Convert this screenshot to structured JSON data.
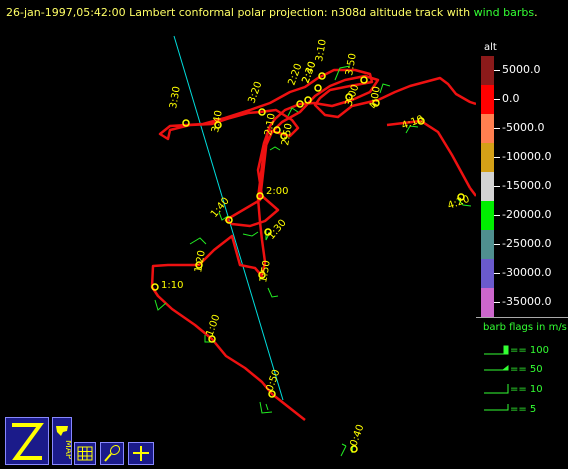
{
  "header": {
    "title_prefix": "26-jan-1997,05:42:00  Lambert conformal polar projection:  n308d altitude track with ",
    "title_highlight": "wind barbs",
    "title_suffix": "."
  },
  "track": {
    "labels": [
      "0:40",
      "0:50",
      "1:00",
      "1:10",
      "1:20",
      "1:30",
      "1:40",
      "1:50",
      "2:00",
      "2:10",
      "2:20",
      "2:30",
      "2:40",
      "2:50",
      "3:00",
      "3:10",
      "3:20",
      "3:30",
      "3:40",
      "3:50",
      "4:00",
      "4:10",
      "4:20",
      "4:30"
    ]
  },
  "legend": {
    "alt_label": "alt",
    "colorbar": [
      {
        "label": "5000.0",
        "color": "#8b1a1a"
      },
      {
        "label": "0.0",
        "color": "#ff0000"
      },
      {
        "label": "-5000.0",
        "color": "#ff7f50"
      },
      {
        "label": "-10000.0",
        "color": "#d4a017"
      },
      {
        "label": "-15000.0",
        "color": "#d3d3d3"
      },
      {
        "label": "-20000.0",
        "color": "#00ee00"
      },
      {
        "label": "-25000.0",
        "color": "#4f8f8f"
      },
      {
        "label": "-30000.0",
        "color": "#6a5acd"
      },
      {
        "label": "-35000.0",
        "color": "#cc66cc"
      }
    ],
    "barb_title": "barb flags in m/s",
    "barb_items": [
      "== 100",
      "== 50",
      "== 10",
      "== 5"
    ]
  },
  "toolbar": {
    "zeb_icon": "z-logo-icon",
    "map_label": "MAP",
    "grid_icon": "grid-icon",
    "racket_icon": "racket-icon",
    "cross_icon": "plane-cross-icon"
  },
  "colors": {
    "track": "#ee1111",
    "point": "#ffff00",
    "label": "#ffff00",
    "cross_line": "#00dddd",
    "barb": "#22ee22"
  }
}
